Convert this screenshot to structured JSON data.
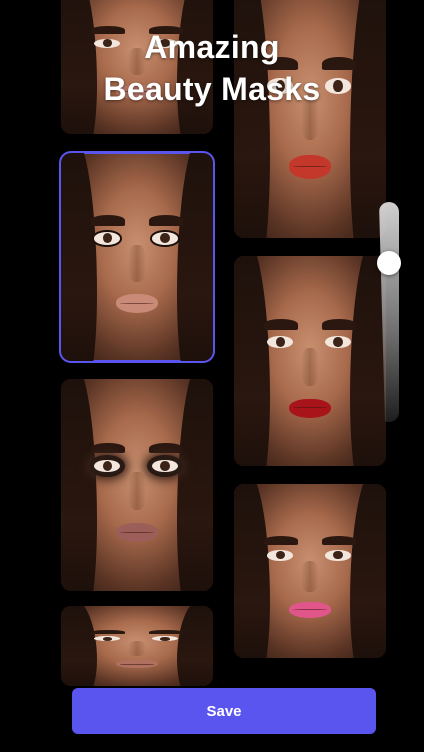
{
  "header": {
    "title_line1": "Amazing",
    "title_line2": "Beauty Masks"
  },
  "masks": [
    {
      "name": "mask-top-left",
      "lip_color": "#b6786a",
      "eye_style": "natural",
      "selected": false
    },
    {
      "name": "mask-natural-nude",
      "lip_color": "#c98a78",
      "eye_style": "liner",
      "selected": true
    },
    {
      "name": "mask-smoky-mauve",
      "lip_color": "#9c5e58",
      "eye_style": "smoky",
      "selected": false
    },
    {
      "name": "mask-bottom-left",
      "lip_color": "#b07060",
      "eye_style": "natural",
      "selected": false
    },
    {
      "name": "mask-coral-red",
      "lip_color": "#c4382c",
      "eye_style": "natural",
      "selected": false
    },
    {
      "name": "mask-deep-red",
      "lip_color": "#a8141a",
      "eye_style": "natural",
      "selected": false
    },
    {
      "name": "mask-pink-gloss",
      "lip_color": "#e0568a",
      "eye_style": "natural",
      "selected": false
    }
  ],
  "intensity_slider": {
    "value": 0.75
  },
  "save_button": {
    "label": "Save"
  },
  "colors": {
    "accent": "#5b55f0",
    "background": "#000000",
    "text": "#ffffff"
  }
}
